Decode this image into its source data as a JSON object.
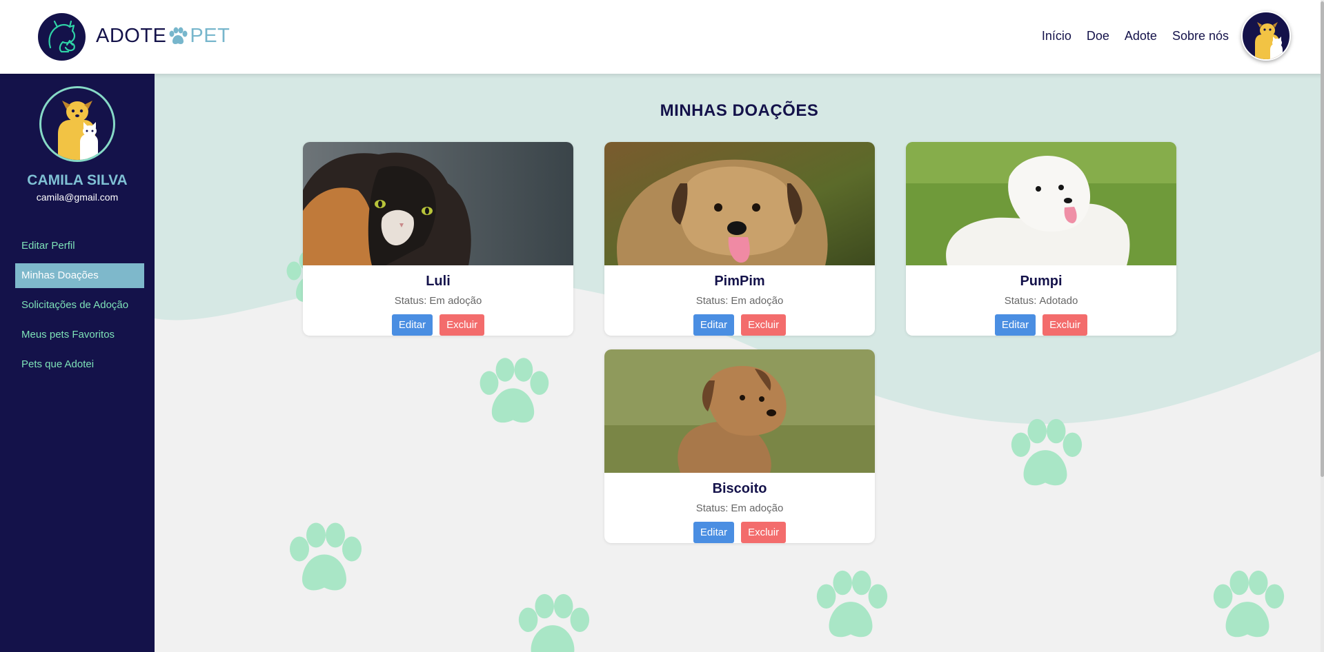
{
  "header": {
    "brand_left": "ADOTE",
    "brand_right": "PET",
    "nav": [
      "Início",
      "Doe",
      "Adote",
      "Sobre nós"
    ]
  },
  "sidebar": {
    "name": "CAMILA SILVA",
    "email": "camila@gmail.com",
    "items": [
      {
        "label": "Editar Perfil",
        "active": false
      },
      {
        "label": "Minhas Doações",
        "active": true
      },
      {
        "label": "Solicitações de Adoção",
        "active": false
      },
      {
        "label": "Meus pets Favoritos",
        "active": false
      },
      {
        "label": "Pets que Adotei",
        "active": false
      }
    ]
  },
  "main": {
    "title": "MINHAS DOAÇÕES",
    "status_label": "Status:",
    "edit_label": "Editar",
    "delete_label": "Excluir",
    "pets": [
      {
        "name": "Luli",
        "status": "Em adoção",
        "photo": "cat-photo"
      },
      {
        "name": "PimPim",
        "status": "Em adoção",
        "photo": "dog-photo"
      },
      {
        "name": "Pumpi",
        "status": "Adotado",
        "photo": "poodle-photo"
      },
      {
        "name": "Biscoito",
        "status": "Em adoção",
        "photo": "puppy-photo"
      }
    ]
  },
  "colors": {
    "navy": "#14124a",
    "accent_blue": "#7eb8cb",
    "mint": "#7ee3b8",
    "edit_button": "#4a8ee2",
    "delete_button": "#f36c6c",
    "wave": "#d6e8e4"
  }
}
